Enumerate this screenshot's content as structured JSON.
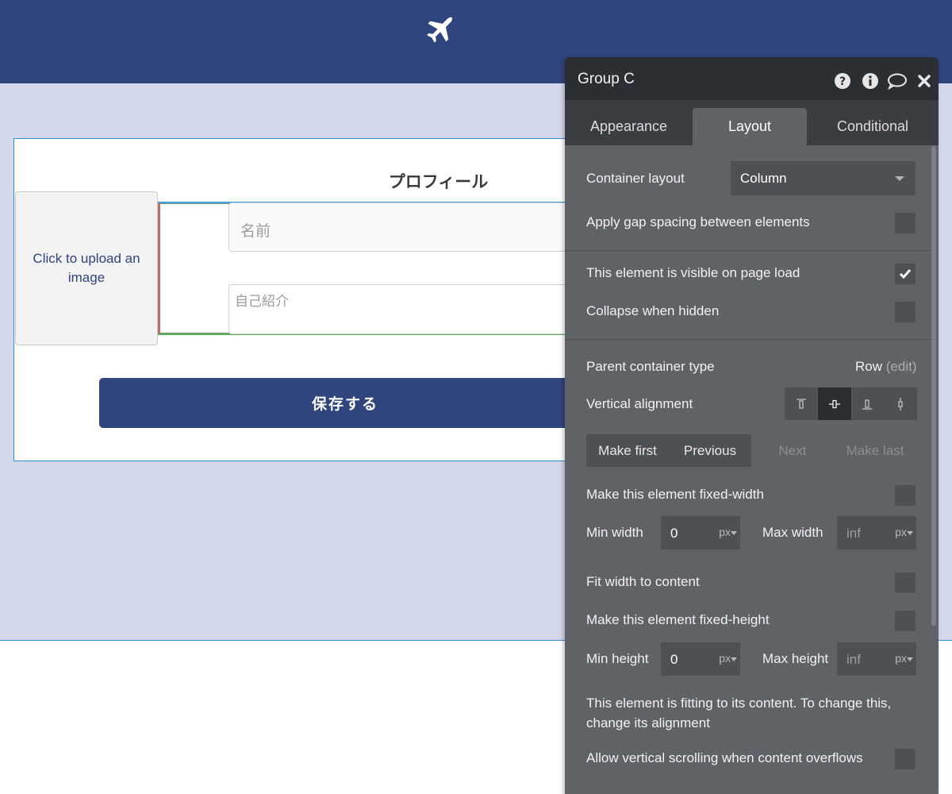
{
  "canvas": {
    "header_icon": "airplane-icon",
    "profile": {
      "title": "プロフィール",
      "upload_text": "Click to upload an image",
      "name_placeholder": "名前",
      "bio_placeholder": "自己紹介",
      "save_label": "保存する"
    },
    "colors": {
      "brand": "#30447d",
      "canvas_bg": "#d4d8ec",
      "selection": "#2d8fd5"
    }
  },
  "panel": {
    "title": "Group C",
    "header_icons": [
      "help-icon",
      "info-icon",
      "comment-icon",
      "close-icon"
    ],
    "tabs": [
      {
        "label": "Appearance",
        "active": false
      },
      {
        "label": "Layout",
        "active": true
      },
      {
        "label": "Conditional",
        "active": false
      }
    ],
    "container_layout": {
      "label": "Container layout",
      "value": "Column"
    },
    "gap_spacing": {
      "label": "Apply gap spacing between elements",
      "checked": false
    },
    "visible_on_load": {
      "label": "This element is visible on page load",
      "checked": true
    },
    "collapse_hidden": {
      "label": "Collapse when hidden",
      "checked": false
    },
    "parent_container": {
      "label": "Parent container type",
      "value": "Row",
      "edit": "(edit)"
    },
    "vertical_alignment": {
      "label": "Vertical alignment",
      "options": [
        "top",
        "center",
        "bottom",
        "stretch"
      ],
      "selected": "center"
    },
    "order_buttons": [
      {
        "label": "Make first",
        "enabled": true
      },
      {
        "label": "Previous",
        "enabled": true
      },
      {
        "label": "Next",
        "enabled": false
      },
      {
        "label": "Make last",
        "enabled": false
      }
    ],
    "fixed_width": {
      "label": "Make this element fixed-width",
      "checked": false
    },
    "min_width": {
      "label": "Min width",
      "value": "0",
      "unit": "px"
    },
    "max_width": {
      "label": "Max width",
      "value": "inf",
      "unit": "px"
    },
    "fit_width": {
      "label": "Fit width to content",
      "checked": false
    },
    "fixed_height": {
      "label": "Make this element fixed-height",
      "checked": false
    },
    "min_height": {
      "label": "Min height",
      "value": "0",
      "unit": "px"
    },
    "max_height": {
      "label": "Max height",
      "value": "inf",
      "unit": "px"
    },
    "fitting_note": "This element is fitting to its content. To change this, change its alignment",
    "vertical_scroll": {
      "label": "Allow vertical scrolling when content overflows",
      "checked": false
    }
  }
}
